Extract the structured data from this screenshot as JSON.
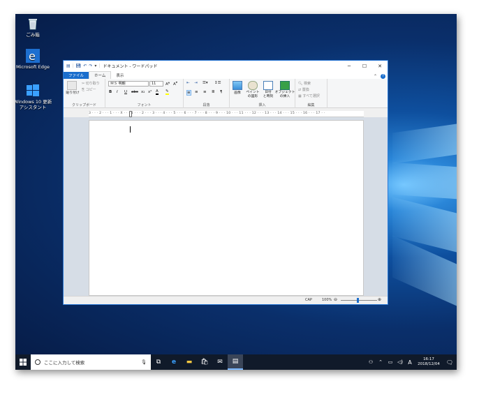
{
  "desktop": {
    "icons": [
      {
        "label": "ごみ箱",
        "icon": "recycle-bin-icon"
      },
      {
        "label": "Microsoft Edge",
        "icon": "edge-icon"
      },
      {
        "label": "Windows 10 更新アシスタント",
        "icon": "windows-logo-icon"
      }
    ]
  },
  "window": {
    "title": "ドキュメント - ワードパッド",
    "tabs": {
      "file": "ファイル",
      "home": "ホーム",
      "view": "表示"
    },
    "ribbon": {
      "clipboard": {
        "label": "クリップボード",
        "paste": "貼り付け",
        "cut": "切り取り",
        "copy": "コピー"
      },
      "font": {
        "label": "フォント",
        "family": "ＭＳ 明朝",
        "size": "11"
      },
      "paragraph": {
        "label": "段落"
      },
      "insert": {
        "label": "挿入",
        "picture": "画像",
        "paint": "ペイント\nの図形",
        "datetime": "日付\nと時刻",
        "object": "オブジェクト\nの挿入"
      },
      "editing": {
        "label": "編集",
        "find": "検索",
        "replace": "置換",
        "select_all": "すべて選択"
      }
    },
    "ruler": "3 · · · 2 · · · 1 · · · X · · · 1 · · · 2 · · · 3 · · · 4 · · · 5 · · · 6 · · · 7 · · · 8 · · · 9 · · · 10 · · · 11 · · · 12 · · · 13 · · · 14 · · · 15 · · · 16 · · · 17 · ·",
    "status": {
      "caps": "CAP",
      "zoom": "100%"
    }
  },
  "taskbar": {
    "search_placeholder": "ここに入力して検索",
    "time": "16:17",
    "date": "2018/12/04",
    "ime": "A"
  },
  "colors": {
    "accent": "#1a6ecd",
    "taskbar": "#101a2a",
    "window_border": "#2b79d6"
  }
}
